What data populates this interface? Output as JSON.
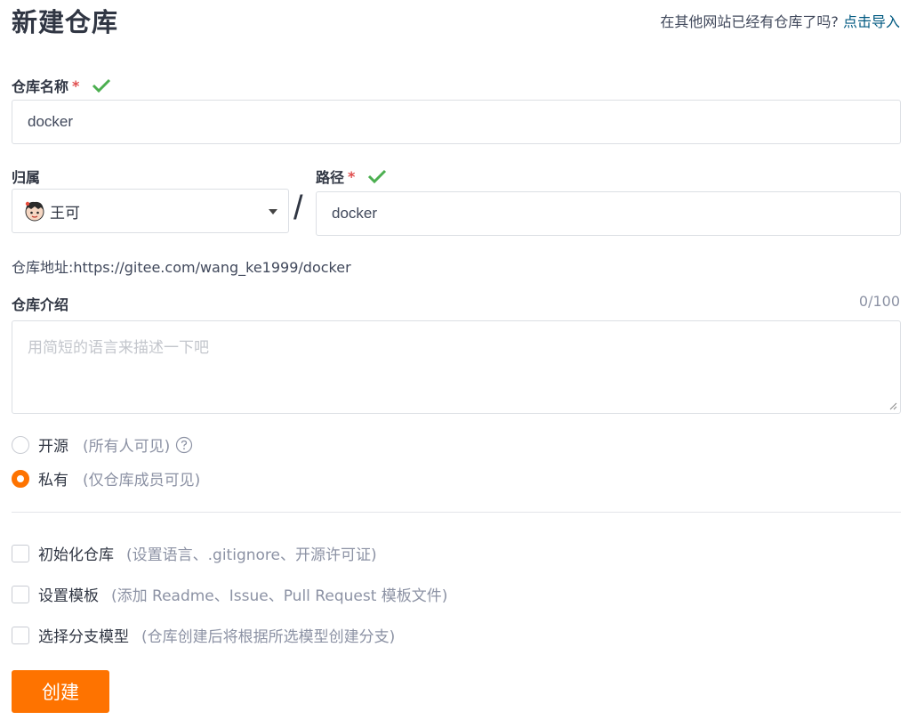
{
  "header": {
    "title": "新建仓库",
    "import_prompt": "在其他网站已经有仓库了吗?",
    "import_link": "点击导入"
  },
  "repo_name": {
    "label": "仓库名称",
    "required_mark": "*",
    "value": "docker",
    "valid_icon": "check-icon"
  },
  "owner": {
    "label": "归属",
    "value": "王可",
    "avatar_icon": "avatar"
  },
  "path": {
    "label": "路径",
    "required_mark": "*",
    "separator": "/",
    "value": "docker",
    "valid_icon": "check-icon"
  },
  "repo_address": "仓库地址:https://gitee.com/wang_ke1999/docker",
  "description": {
    "label": "仓库介绍",
    "counter": "0/100",
    "placeholder": "用简短的语言来描述一下吧",
    "value": ""
  },
  "visibility": [
    {
      "label": "开源",
      "hint": "(所有人可见)",
      "checked": false,
      "has_help": true
    },
    {
      "label": "私有",
      "hint": "(仅仓库成员可见)",
      "checked": true,
      "has_help": false
    }
  ],
  "options": [
    {
      "label": "初始化仓库",
      "hint": "(设置语言、.gitignore、开源许可证)",
      "checked": false
    },
    {
      "label": "设置模板",
      "hint": "(添加 Readme、Issue、Pull Request 模板文件)",
      "checked": false
    },
    {
      "label": "选择分支模型",
      "hint": "(仓库创建后将根据所选模型创建分支)",
      "checked": false
    }
  ],
  "submit_label": "创建",
  "colors": {
    "accent": "#fe7300",
    "valid": "#4caf50",
    "required": "#e04e4e",
    "link": "#005980"
  }
}
